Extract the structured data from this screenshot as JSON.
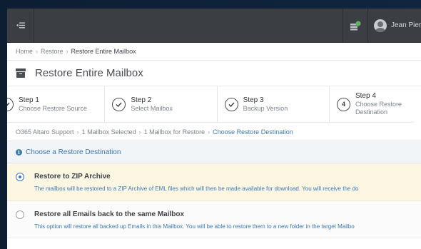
{
  "topbar": {
    "menu_icon": "menu-collapse-icon",
    "notification_icon": "server-status-icon",
    "user_name": "Jean Pierr"
  },
  "breadcrumb": {
    "items": [
      "Home",
      "Restore",
      "Restore Entire Mailbox"
    ]
  },
  "page": {
    "title": "Restore Entire Mailbox",
    "icon": "archive-box-icon"
  },
  "steps": [
    {
      "title": "Step 1",
      "subtitle": "Choose Restore Source",
      "state": "done"
    },
    {
      "title": "Step 2",
      "subtitle": "Select Mailbox",
      "state": "done"
    },
    {
      "title": "Step 3",
      "subtitle": "Backup Version",
      "state": "done"
    },
    {
      "title": "Step 4",
      "subtitle": "Choose Restore Destination",
      "number": "4",
      "state": "current"
    }
  ],
  "trail": {
    "items": [
      "O365 Altaro Support",
      "1 Mailbox Selected",
      "1 Mailbox for Restore",
      "Choose Restore Destination"
    ]
  },
  "section": {
    "title": "Choose a Restore Destination"
  },
  "options": [
    {
      "title": "Restore to ZIP Archive",
      "description": "The mailbox will be restored to a ZIP Archive of EML files which will then be made available for download. You will receive the do",
      "selected": true
    },
    {
      "title": "Restore all Emails back to the same Mailbox",
      "description": "This option will restore all backed up Emails in this Mailbox. You will be able to restore them to a new folder in the target Mailbo",
      "selected": false
    }
  ],
  "colors": {
    "accent": "#3a78b6",
    "topbar": "#3b3e42",
    "selected_bg": "#fcf6e3"
  }
}
